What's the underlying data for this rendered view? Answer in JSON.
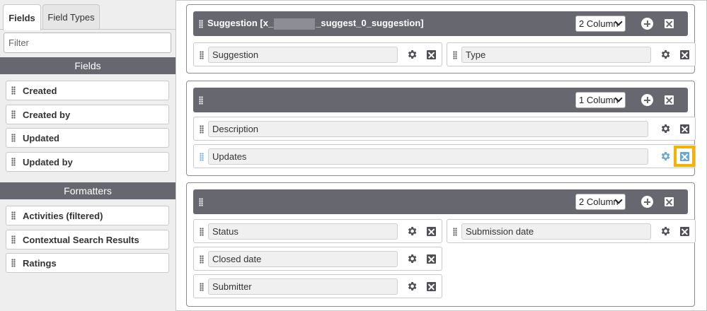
{
  "left_panel": {
    "tabs": [
      "Fields",
      "Field Types"
    ],
    "filter_placeholder": "Filter",
    "fields_header": "Fields",
    "fields": [
      "Created",
      "Created by",
      "Updated",
      "Updated by"
    ],
    "formatters_header": "Formatters",
    "formatters": [
      "Activities (filtered)",
      "Contextual Search Results",
      "Ratings"
    ]
  },
  "sections": [
    {
      "title_prefix": "Suggestion [x_",
      "title_suffix": "_suggest_0_suggestion]",
      "columns": "2 Column",
      "fields": [
        "Suggestion",
        "Type"
      ]
    },
    {
      "title": "",
      "columns": "1 Column",
      "fields": [
        "Description",
        "Updates"
      ]
    },
    {
      "title": "",
      "columns": "2 Column",
      "fields": [
        "Status",
        "Submission date",
        "Closed date",
        "Submitter"
      ]
    }
  ],
  "colors": {
    "header_bg": "#67676f",
    "highlight": "#f5b301",
    "active_icon": "#6aa6d6"
  }
}
